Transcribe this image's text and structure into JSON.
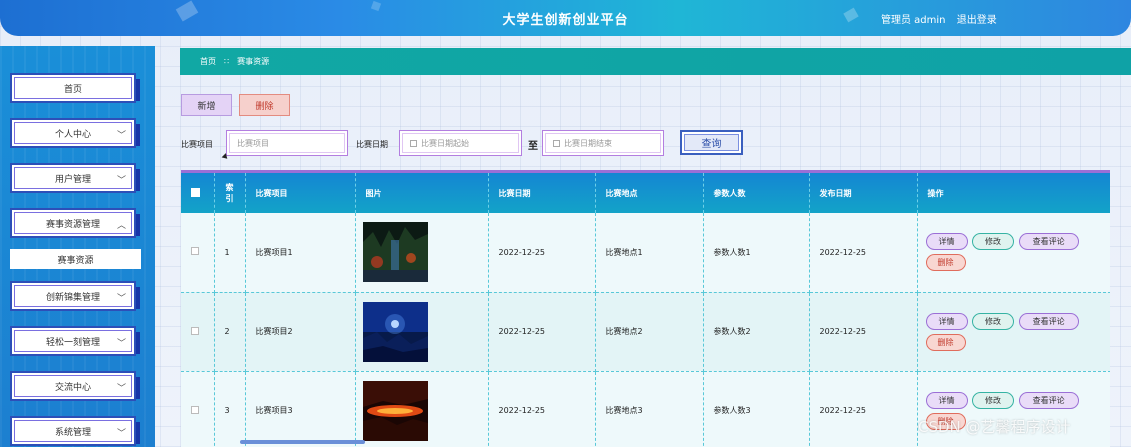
{
  "header": {
    "title": "大学生创新创业平台",
    "user_label": "管理员 admin",
    "logout_label": "退出登录"
  },
  "sidebar": {
    "items": [
      {
        "label": "首页",
        "has_children": false
      },
      {
        "label": "个人中心",
        "has_children": true
      },
      {
        "label": "用户管理",
        "has_children": true
      },
      {
        "label": "赛事资源管理",
        "has_children": true,
        "expanded": true
      },
      {
        "label": "创新锦集管理",
        "has_children": true
      },
      {
        "label": "轻松一刻管理",
        "has_children": true
      },
      {
        "label": "交流中心",
        "has_children": true
      },
      {
        "label": "系统管理",
        "has_children": true
      }
    ],
    "submenu": {
      "label": "赛事资源"
    }
  },
  "breadcrumb": {
    "home": "首页",
    "separator": "∷",
    "current": "赛事资源"
  },
  "actions": {
    "add_label": "新增",
    "delete_label": "删除"
  },
  "search": {
    "project_label": "比赛项目",
    "project_placeholder": "比赛项目",
    "date_label": "比赛日期",
    "date_start_placeholder": "比赛日期起始",
    "to_label": "至",
    "date_end_placeholder": "比赛日期结束",
    "query_label": "查询"
  },
  "table": {
    "columns": [
      "索引",
      "比赛项目",
      "图片",
      "比赛日期",
      "比赛地点",
      "参数人数",
      "发布日期",
      "操作"
    ],
    "index_header_line1": "索",
    "index_header_line2": "引",
    "rows": [
      {
        "index": "1",
        "project": "比赛项目1",
        "image": "night-forest-waterfall",
        "date": "2022-12-25",
        "location": "比赛地点1",
        "participants": "参数人数1",
        "publish_date": "2022-12-25"
      },
      {
        "index": "2",
        "project": "比赛项目2",
        "image": "blue-moon-landscape",
        "date": "2022-12-25",
        "location": "比赛地点2",
        "participants": "参数人数2",
        "publish_date": "2022-12-25"
      },
      {
        "index": "3",
        "project": "比赛项目3",
        "image": "red-lava-cave",
        "date": "2022-12-25",
        "location": "比赛地点3",
        "participants": "参数人数3",
        "publish_date": "2022-12-25"
      }
    ],
    "ops": {
      "detail": "详情",
      "edit": "修改",
      "comment": "查看评论",
      "delete": "删除"
    }
  },
  "watermark": "CSDN @艺馨程序设计",
  "colors": {
    "header_gradient_start": "#1d6fd2",
    "header_gradient_end": "#1fb6d6",
    "sidebar": "#1a8fd8",
    "breadcrumb": "#11a8a4",
    "table_header": "#1486d3",
    "delete_red": "#c0392b"
  }
}
